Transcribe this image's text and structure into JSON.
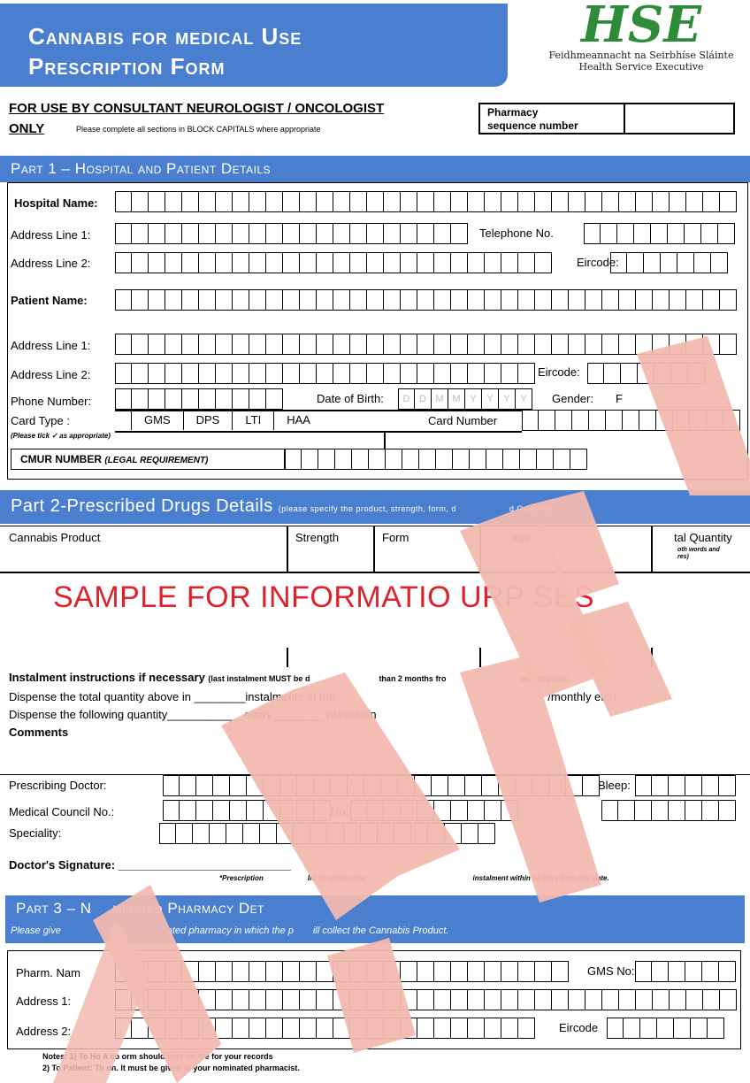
{
  "header": {
    "title_line1": "Cannabis for medical Use",
    "title_line2": "Prescription Form",
    "logo_irish": "Feidhmeannacht na Seirbhíse Sláinte",
    "logo_english": "Health Service Executive"
  },
  "intro": {
    "use_by": "FOR USE BY CONSULTANT NEUROLOGIST / ONCOLOGIST",
    "only": "ONLY",
    "block_capitals": "Please complete all sections in BLOCK CAPITALS where appropriate",
    "pharmacy_seq_line1": "Pharmacy",
    "pharmacy_seq_line2": "sequence number"
  },
  "part1": {
    "title": "Part 1 – Hospital and Patient Details",
    "hospital_name": "Hospital Name:",
    "address_line1": "Address Line 1:",
    "telephone": "Telephone No.",
    "address_line2": "Address Line 2:",
    "eircode": "Eircode:",
    "patient_name": "Patient Name:",
    "p_address_line1": "Address Line 1:",
    "p_address_line2": "Address Line 2:",
    "p_eircode": "Eircode:",
    "phone_number": "Phone Number:",
    "dob": "Date of Birth:",
    "dob_cells": [
      "D",
      "D",
      "M",
      "M",
      "Y",
      "Y",
      "Y",
      "Y"
    ],
    "gender": "Gender:",
    "gender_f": "F",
    "card_type": "Card Type :",
    "tick_note": "(Please tick ✓ as appropriate)",
    "card_types": [
      "GMS",
      "DPS",
      "LTI",
      "HAA"
    ],
    "card_number": "Card Number",
    "cmur": "CMUR NUMBER",
    "cmur_note": "(LEGAL REQUIREMENT)"
  },
  "part2": {
    "title": "Part 2-Prescribed Drugs Details",
    "title_note": "(please specify the product, strength, form, d",
    "title_note2": "d Quantity)",
    "col_product": "Cannabis Product",
    "col_strength": "Strength",
    "col_form": "Form",
    "col_dosage": "age",
    "col_total": "tal Quantity",
    "col_total_note1": "oth words and",
    "col_total_note2": "res)",
    "sample_text": "SAMPLE FOR INFORMATIO  URP  SES",
    "instalment_title": "Instalment instructions if necessary",
    "instalment_note": "(last instalment MUST be d",
    "instalment_note2": "than 2 months fro",
    "instalment_note3": "prescription)",
    "dispense_total": "Dispense the total quantity above in ________instalments at the",
    "dispense_total_tail": "/monthly etc.)",
    "dispense_following": "Dispense the following quantity____________every________ (day",
    "dispense_following_tail": "eks/n",
    "comments": "Comments",
    "prescribing_doctor": "Prescribing Doctor:",
    "bleep": "Bleep:",
    "medical_council": "Medical Council No.:",
    "no_label": "No:",
    "speciality": "Speciality:",
    "doctor_signature": "Doctor's Signature: ___________________________",
    "valid_note": "*Prescription",
    "valid_note2": "lid for dispensing",
    "valid_note3": "instalment within 14 days from this date."
  },
  "part3": {
    "title": "Part 3 – N",
    "title_tail": "minated Pharmacy Det",
    "subtitle": "Please give",
    "subtitle_mid": "ated pharmacy in which the p",
    "subtitle_tail": "ill collect the Cannabis Product.",
    "pharm_name": "Pharm. Nam",
    "gms_no": "GMS No:",
    "address1": "Address 1:",
    "address2": "Address 2:",
    "eircode": "Eircode"
  },
  "notes": {
    "line1": "Notes: 1) To Ho        A co        orm should kept on file for your records",
    "line2": "2) To Patient: Th               on. It must be given to your nominated pharmacist."
  },
  "colors": {
    "header_blue": "#4a7fd0",
    "sample_red": "#e0202a",
    "watermark": "#f2b9b0",
    "logo_green": "#2e8b3a"
  }
}
